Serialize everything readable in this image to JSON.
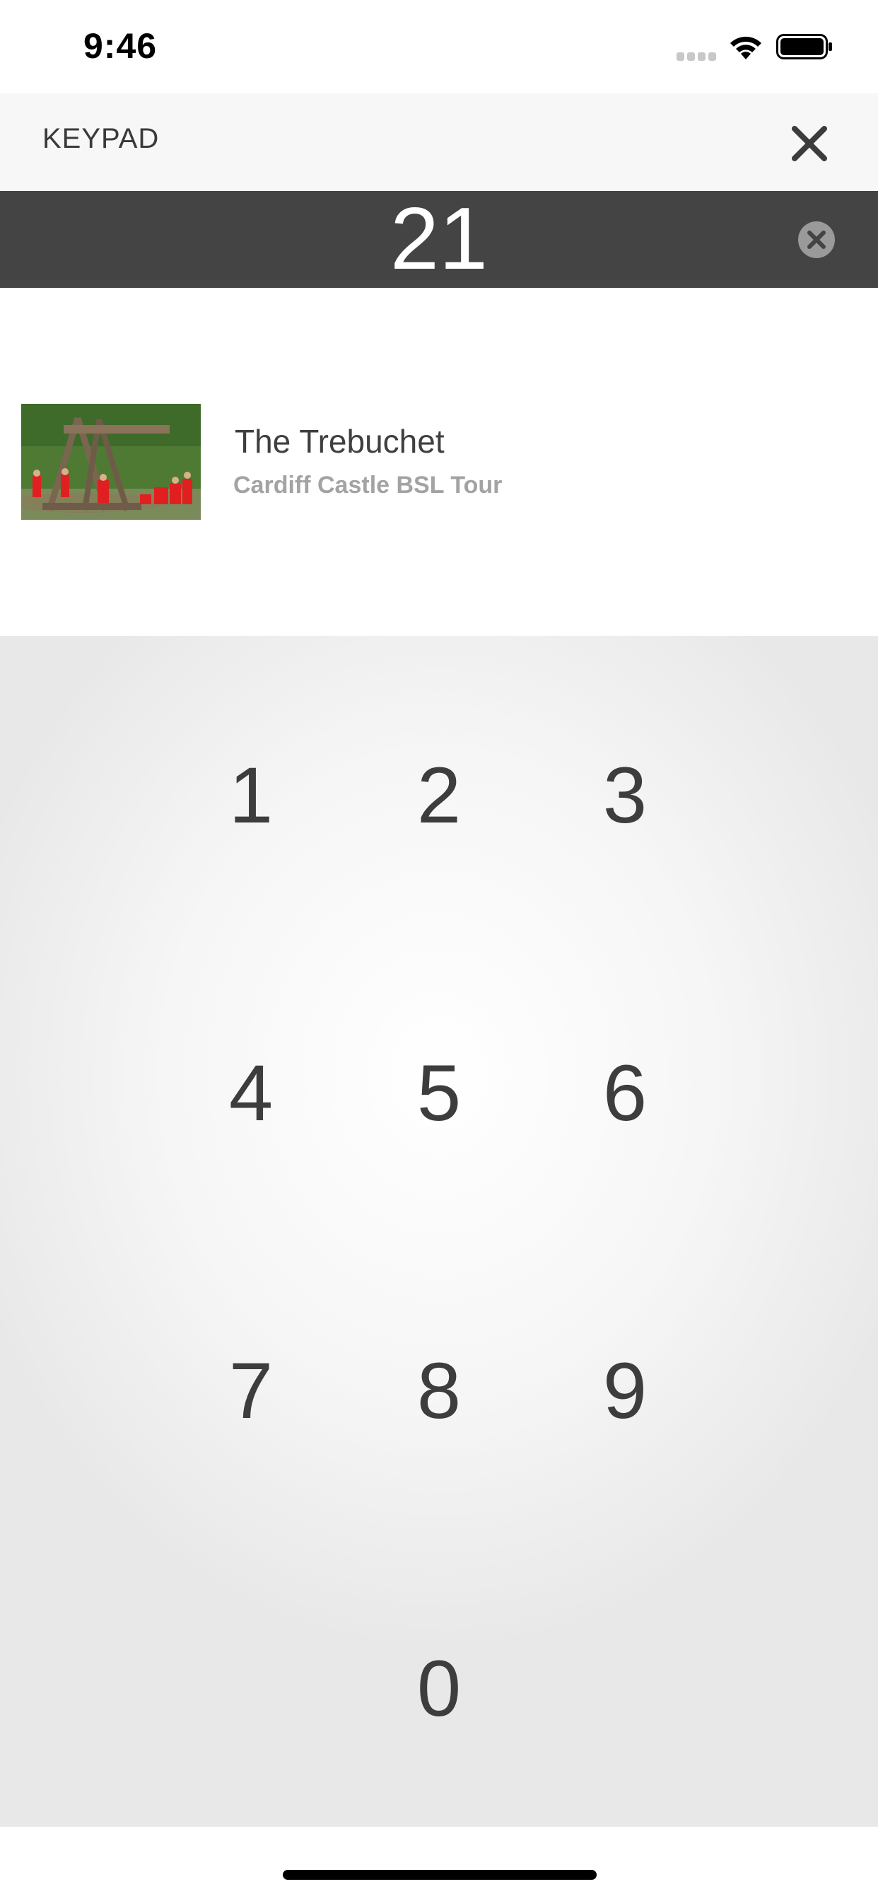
{
  "status_bar": {
    "time": "9:46",
    "icons": [
      "signal-icon",
      "wifi-icon",
      "battery-icon"
    ]
  },
  "header": {
    "title": "KEYPAD",
    "close_icon": "close-icon"
  },
  "entry": {
    "value": "21",
    "clear_icon": "clear-circle-icon",
    "background": "#444444"
  },
  "result": {
    "title": "The Trebuchet",
    "subtitle": "Cardiff Castle BSL Tour"
  },
  "keypad": {
    "keys": [
      "1",
      "2",
      "3",
      "4",
      "5",
      "6",
      "7",
      "8",
      "9",
      "0"
    ]
  },
  "colors": {
    "header_bg": "#f7f7f7",
    "entry_bg": "#444444",
    "key_text": "#3d3d3d",
    "subtitle_text": "#a3a3a3"
  }
}
